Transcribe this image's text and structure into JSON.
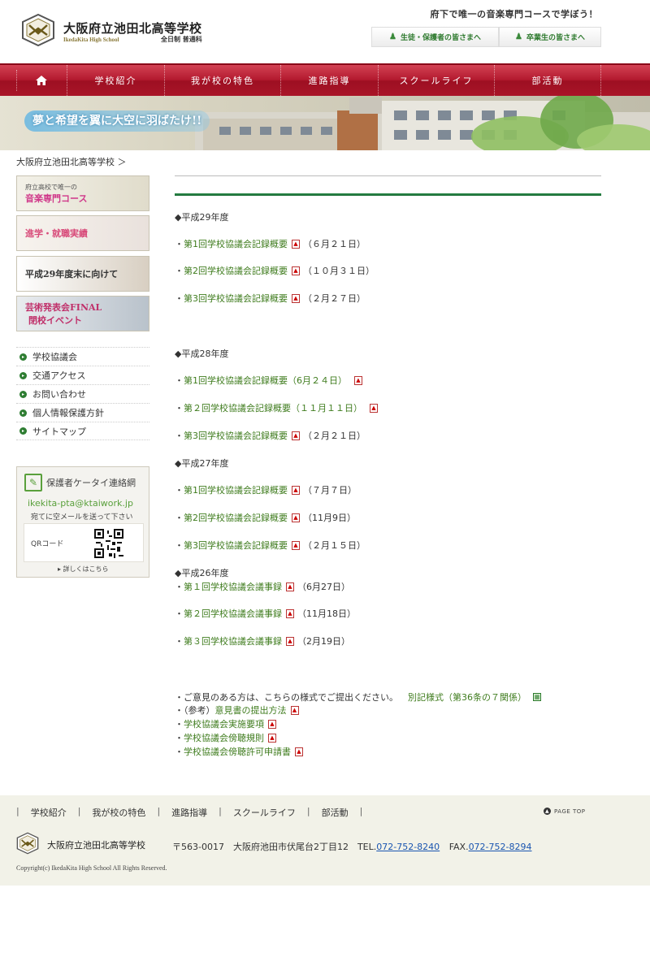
{
  "header": {
    "title": "大阪府立池田北高等学校",
    "subtitle_en": "IkedaKita High School",
    "subtitle_jp": "全日制 普通科",
    "catch": "府下で唯一の音楽専門コースで学ぼう！",
    "btn_parents": "生徒・保護者の皆さまへ",
    "btn_alumni": "卒業生の皆さまへ"
  },
  "nav": {
    "home_icon": "home-icon",
    "items": [
      "学校紹介",
      "我が校の特色",
      "進路指導",
      "スクールライフ",
      "部活動"
    ]
  },
  "banner": {
    "text": "夢と希望を翼に大空に羽ばたけ!!"
  },
  "breadcrumb": "大阪府立池田北高等学校 ＞",
  "sidebar": {
    "banners": [
      {
        "line1": "府立高校で唯一の",
        "line2": "音楽専門コース"
      },
      {
        "line1": "進学・就職実績"
      },
      {
        "line1": "平成29年度末に向けて"
      },
      {
        "line1": "芸術発表会FINAL",
        "line2": "閉校イベント"
      }
    ],
    "links": [
      "学校協議会",
      "交通アクセス",
      "お問い合わせ",
      "個人情報保護方針",
      "サイトマップ"
    ],
    "keitai": {
      "title": "保護者ケータイ連絡網",
      "email": "ikekita-pta@ktaiwork.jp",
      "note": "宛てに空メールを送って下さい",
      "qr_label": "QRコード",
      "more": "▸ 詳しくはこちら"
    }
  },
  "main": {
    "h29": {
      "heading": "◆平成29年度",
      "items": [
        {
          "bullet": "・",
          "link": "第1回学校協議会記録概要",
          "date": "（６月２１日）"
        },
        {
          "bullet": "・",
          "link": "第2回学校協議会記録概要",
          "date": "（１０月３１日）"
        },
        {
          "bullet": "・",
          "link": "第3回学校協議会記録概要",
          "date": "（２月２７日）"
        }
      ]
    },
    "h28": {
      "heading": "◆平成28年度",
      "items": [
        {
          "bullet": "・",
          "link": "第1回学校協議会記録概要（6月２４日）",
          "date": ""
        },
        {
          "bullet": "・",
          "link": "第２回学校協議会記録概要（１１月１１日）",
          "date": ""
        },
        {
          "bullet": "・",
          "link": "第3回学校協議会記録概要",
          "date": "（２月２１日）"
        }
      ]
    },
    "h27": {
      "heading": "◆平成27年度",
      "items": [
        {
          "bullet": "・",
          "link": "第1回学校協議会記録概要",
          "date": "（７月７日）"
        },
        {
          "bullet": "・",
          "link": "第2回学校協議会記録概要",
          "date": "（11月9日）"
        },
        {
          "bullet": "・",
          "link": "第3回学校協議会記録概要",
          "date": "（２月１５日）"
        }
      ]
    },
    "h26": {
      "heading": "◆平成26年度",
      "items": [
        {
          "bullet": "・",
          "link": "第１回学校協議会議事録",
          "date": "（6月27日）"
        },
        {
          "bullet": "・",
          "link": "第２回学校協議会議事録",
          "date": "（11月18日）"
        },
        {
          "bullet": "・",
          "link": "第３回学校協議会議事録",
          "date": "（2月19日）"
        }
      ]
    },
    "notes": {
      "opinion_text": "・ご意見のある方は、こちらの様式でご提出ください。",
      "opinion_link": "別記様式（第36条の７関係）",
      "ref_prefix": "・（参考）",
      "ref_link": "意見書の提出方法",
      "link1": "学校協議会実施要項",
      "link2": "学校協議会傍聴規則",
      "link3": "学校協議会傍聴許可申請書",
      "bullet": "・"
    }
  },
  "footer": {
    "nav": [
      "学校紹介",
      "我が校の特色",
      "進路指導",
      "スクールライフ",
      "部活動"
    ],
    "pagetop": "PAGE TOP",
    "name": "大阪府立池田北高等学校",
    "address": "〒563-0017　大阪府池田市伏尾台2丁目12　TEL.",
    "tel": "072-752-8240",
    "fax_label": "FAX.",
    "fax": "072-752-8294",
    "copyright": "Copyright(c) IkedaKita High School All Rights Reserved."
  },
  "colors": {
    "nav_red": "#b3192e",
    "accent_green": "#3f7c1e",
    "footer_bg": "#f2f2e8"
  }
}
